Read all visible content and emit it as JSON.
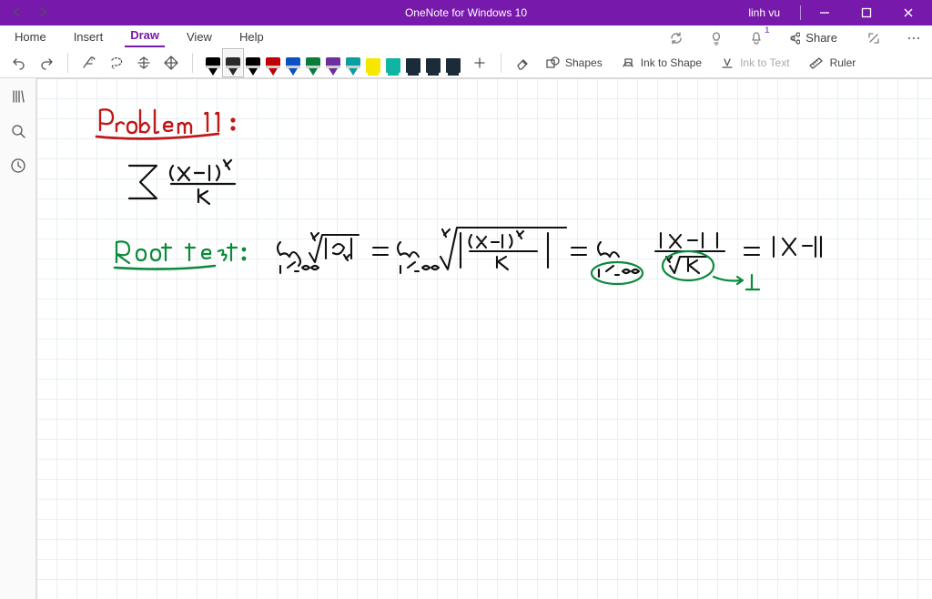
{
  "titlebar": {
    "app": "OneNote for Windows 10",
    "user": "linh vu"
  },
  "menus": {
    "home": "Home",
    "insert": "Insert",
    "draw": "Draw",
    "view": "View",
    "help": "Help",
    "share": "Share",
    "notification_count": "1"
  },
  "ribbon": {
    "shapes": "Shapes",
    "ink_to_shape": "Ink to Shape",
    "ink_to_text": "Ink to Text",
    "ruler": "Ruler"
  },
  "pens": [
    {
      "name": "pen-black-thin",
      "color": "#000000",
      "selected": false
    },
    {
      "name": "pen-black-thick",
      "color": "#2a2a2a",
      "selected": true
    },
    {
      "name": "pen-black-3",
      "color": "#000000",
      "selected": false
    },
    {
      "name": "pen-red",
      "color": "#c00000",
      "selected": false
    },
    {
      "name": "pen-blue",
      "color": "#0a52c2",
      "selected": false
    },
    {
      "name": "pen-green",
      "color": "#0a7d3a",
      "selected": false
    },
    {
      "name": "pen-purple",
      "color": "#6b2fa0",
      "selected": false
    },
    {
      "name": "pen-teal",
      "color": "#0aa0a0",
      "selected": false
    },
    {
      "name": "hl-yellow",
      "color": "#f6e600",
      "selected": false,
      "highlighter": true
    },
    {
      "name": "hl-teal",
      "color": "#0fb5a2",
      "selected": false,
      "highlighter": true
    },
    {
      "name": "hl-dark1",
      "color": "#1b2b3a",
      "selected": false,
      "highlighter": true
    },
    {
      "name": "hl-dark2",
      "color": "#1b2b3a",
      "selected": false,
      "highlighter": true
    },
    {
      "name": "hl-dark3",
      "color": "#1b2b3a",
      "selected": false,
      "highlighter": true
    }
  ],
  "handwriting": {
    "title": "Problem 11 :",
    "series_expr": "Σ (x−1)^k / k",
    "label_root_test": "Root test :",
    "work": "lim_{k→∞} k√|a_k| = lim_{k→∞} k√|(x−1)^k / k| = lim_{k→∞} |x−1| / k√k = |x−1|",
    "annotation": "k√k → 1"
  }
}
